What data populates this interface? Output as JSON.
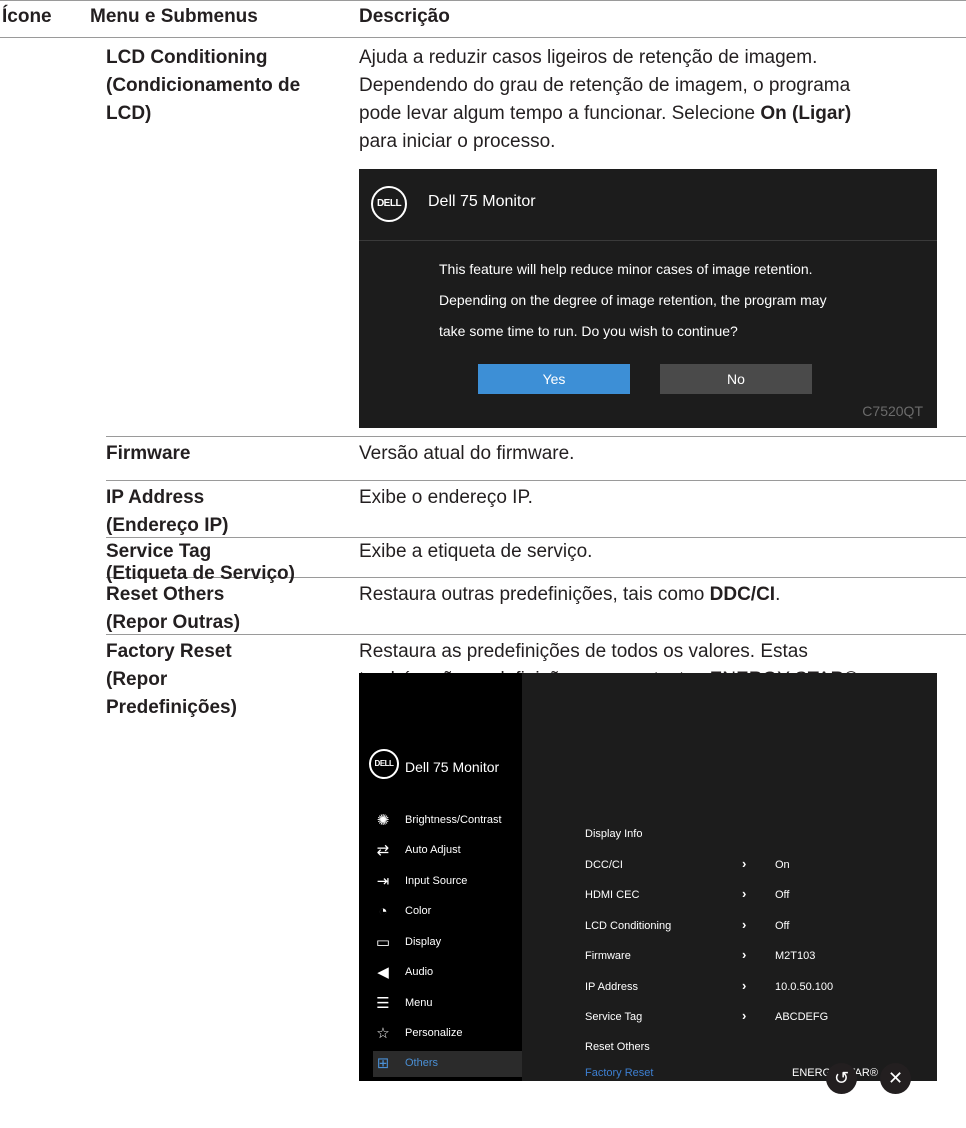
{
  "header": {
    "col_icon": "Ícone",
    "col_menu": "Menu e Submenus",
    "col_desc": "Descrição"
  },
  "rows": {
    "lcd": {
      "name_line1": "LCD Conditioning",
      "name_line2": "(Condicionamento de",
      "name_line3": "LCD)",
      "desc_line1": "Ajuda a reduzir casos ligeiros de retenção de imagem.",
      "desc_line2": "Dependendo do grau de retenção de imagem, o programa",
      "desc_line3_pre": "pode levar algum tempo a funcionar. Selecione ",
      "desc_line3_bold": "On (Ligar)",
      "desc_line4": "para iniciar o processo."
    },
    "firmware": {
      "name": "Firmware",
      "desc": "Versão atual do firmware."
    },
    "ip": {
      "name_line1": "IP Address",
      "name_line2": "(Endereço IP)",
      "desc": "Exibe o endereço IP."
    },
    "service": {
      "name_line1": "Service Tag",
      "name_line2": "(Etiqueta de Serviço)",
      "desc": "Exibe a etiqueta de serviço."
    },
    "reset_others": {
      "name_line1": "Reset Others",
      "name_line2": "(Repor Outras)",
      "desc_pre": "Restaura outras predefinições, tais como ",
      "desc_bold": "DDC/CI",
      "desc_post": "."
    },
    "factory": {
      "name_line1": "Factory Reset",
      "name_line2": "(Repor",
      "name_line3": "Predefinições)",
      "desc_line1": "Restaura as predefinições de todos os valores. Estas",
      "desc_line2": "também são as definições para os testes ENERGY STAR®."
    }
  },
  "dialog": {
    "logo": "DELL",
    "title": "Dell 75 Monitor",
    "msg_line1": "This feature will help reduce minor cases of image retention.",
    "msg_line2": "Depending on the degree of image retention, the program may",
    "msg_line3": "take some time to run. Do you wish to continue?",
    "yes_label": "Yes",
    "no_label": "No",
    "model": "C7520QT",
    "colors": {
      "background": "#1c1c1c",
      "yes": "#3d8fd6",
      "no": "#4a4a4a"
    }
  },
  "osd": {
    "logo": "DELL",
    "title": "Dell 75 Monitor",
    "menu": [
      {
        "label": "Brightness/Contrast",
        "icon": "brightness-icon",
        "selected": false
      },
      {
        "label": "Auto Adjust",
        "icon": "auto-adjust-icon",
        "selected": false
      },
      {
        "label": "Input Source",
        "icon": "input-source-icon",
        "selected": false
      },
      {
        "label": "Color",
        "icon": "color-icon",
        "selected": false
      },
      {
        "label": "Display",
        "icon": "display-icon",
        "selected": false
      },
      {
        "label": "Audio",
        "icon": "audio-icon",
        "selected": false
      },
      {
        "label": "Menu",
        "icon": "menu-icon",
        "selected": false
      },
      {
        "label": "Personalize",
        "icon": "star-icon",
        "selected": false
      },
      {
        "label": "Others",
        "icon": "others-icon",
        "selected": true
      }
    ],
    "right": [
      {
        "label": "Display Info",
        "value": "",
        "has_chevron": false,
        "selected": false
      },
      {
        "label": "DCC/CI",
        "value": "On",
        "has_chevron": true,
        "selected": false
      },
      {
        "label": "HDMI CEC",
        "value": "Off",
        "has_chevron": true,
        "selected": false
      },
      {
        "label": "LCD Conditioning",
        "value": "Off",
        "has_chevron": true,
        "selected": false
      },
      {
        "label": "Firmware",
        "value": "M2T103",
        "has_chevron": true,
        "selected": false
      },
      {
        "label": "IP Address",
        "value": "10.0.50.100",
        "has_chevron": true,
        "selected": false
      },
      {
        "label": "Service Tag",
        "value": "ABCDEFG",
        "has_chevron": true,
        "selected": false
      },
      {
        "label": "Reset Others",
        "value": "",
        "has_chevron": false,
        "selected": false
      },
      {
        "label": "Factory Reset",
        "value": "ENERGY STAR®",
        "has_chevron": false,
        "selected": true
      }
    ],
    "colors": {
      "accent": "#3d7fd1",
      "panel": "#1c1c1c"
    }
  },
  "bottom_buttons": {
    "back": "back-icon",
    "close": "close-icon"
  }
}
